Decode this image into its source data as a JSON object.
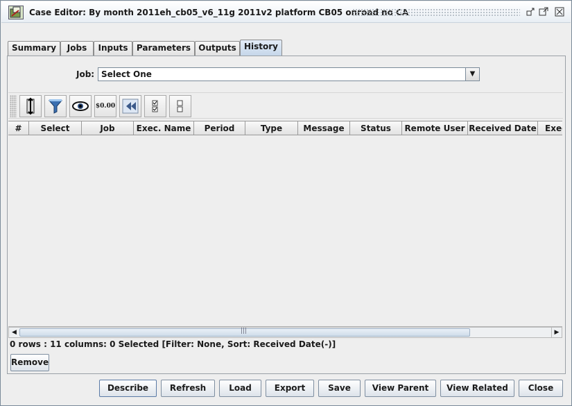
{
  "window": {
    "title": "Case Editor: By month 2011eh_cb05_v6_11g 2011v2 platform CB05 onroad no CA",
    "controls": [
      "minimize-icon",
      "maximize-icon",
      "close-icon"
    ]
  },
  "tabs": [
    {
      "label": "Summary",
      "active": false
    },
    {
      "label": "Jobs",
      "active": false
    },
    {
      "label": "Inputs",
      "active": false
    },
    {
      "label": "Parameters",
      "active": false
    },
    {
      "label": "Outputs",
      "active": false
    },
    {
      "label": "History",
      "active": true
    }
  ],
  "job_filter": {
    "label": "Job:",
    "value": "Select One"
  },
  "toolbar": {
    "icons": [
      "sort-icon",
      "filter-icon",
      "view-icon",
      "format-icon",
      "reset-icon",
      "select-all-icon",
      "clear-selection-icon"
    ],
    "format_text": "$0.00"
  },
  "table": {
    "columns": [
      "#",
      "Select",
      "Job",
      "Exec. Name",
      "Period",
      "Type",
      "Message",
      "Status",
      "Remote User",
      "Received Date",
      "Exec"
    ],
    "rows": []
  },
  "status_text": "0 rows : 11 columns: 0 Selected [Filter: None, Sort: Received Date(-)]",
  "buttons": {
    "remove": "Remove",
    "describe": "Describe",
    "refresh": "Refresh",
    "load": "Load",
    "export": "Export",
    "save": "Save",
    "view_parent": "View Parent",
    "view_related": "View Related",
    "close": "Close"
  }
}
